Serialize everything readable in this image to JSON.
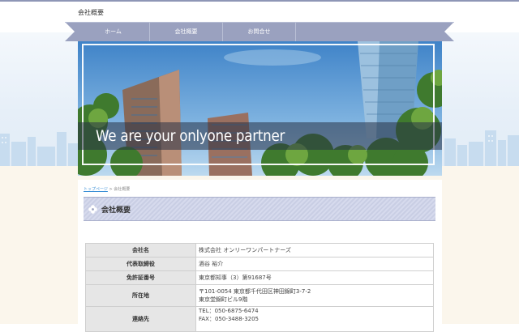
{
  "site": {
    "title": "会社概要"
  },
  "nav": {
    "items": [
      {
        "label": "ホーム"
      },
      {
        "label": "会社概要"
      },
      {
        "label": "お問合せ"
      }
    ]
  },
  "hero": {
    "tagline": "We are your onlyone partner"
  },
  "breadcrumb": {
    "home": "トップページ",
    "separator": ">",
    "current": "会社概要"
  },
  "page": {
    "heading": "会社概要"
  },
  "company_table": {
    "rows": [
      {
        "label": "会社名",
        "values": [
          "株式会社 オンリーワンパートナーズ"
        ]
      },
      {
        "label": "代表取締役",
        "values": [
          "酒谷 裕介"
        ]
      },
      {
        "label": "免許証番号",
        "values": [
          "東京都知事（3）第91687号"
        ]
      },
      {
        "label": "所在地",
        "values": [
          "〒101-0054 東京都千代田区神田錦町3-7-2",
          "東京堂錦町ビル9階"
        ]
      },
      {
        "label": "連絡先",
        "values": [
          "TEL：050-6875-6474",
          "FAX：050-3488-3205"
        ]
      }
    ]
  },
  "colors": {
    "nav": "#9aa1bf",
    "heading_stripe": "#c9cee4",
    "link": "#3a8fd6",
    "ground": "#fbf6ec"
  }
}
